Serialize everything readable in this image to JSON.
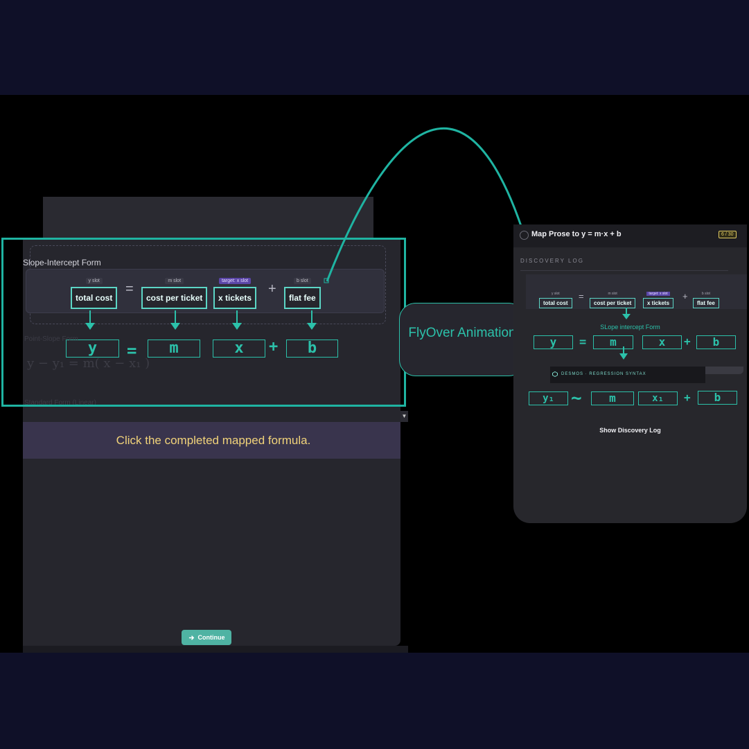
{
  "left_panel": {
    "section_title": "Slope-Intercept Form",
    "slots": [
      {
        "tag": "y slot",
        "label": "total cost",
        "target": false
      },
      {
        "tag": "m slot",
        "label": "cost per ticket",
        "target": false
      },
      {
        "tag": "target: x slot",
        "label": "x tickets",
        "target": true
      },
      {
        "tag": "b slot",
        "label": "flat fee",
        "target": false
      }
    ],
    "equals": "=",
    "plus": "+",
    "formula": {
      "y": "y",
      "m": "m",
      "x": "x",
      "b": "b",
      "equals": "=",
      "plus": "+"
    },
    "faint_heading_1": "Point-Slope Form",
    "faint_math": "y − y₁ = m( x − x₁ )",
    "faint_heading_2": "Standard Form (Linear)",
    "prompt": "Click the completed mapped formula.",
    "continue_label": "Continue",
    "continue_icon": "arrow-right-icon"
  },
  "flyover": {
    "label": "FlyOver Animation"
  },
  "right_panel": {
    "title": "Map Prose to y = m·x + b",
    "badge": "6 / 30",
    "log_heading": "DISCOVERY LOG",
    "slots": [
      {
        "tag": "y slot",
        "label": "total cost",
        "target": false
      },
      {
        "tag": "m slot",
        "label": "cost per ticket",
        "target": false
      },
      {
        "tag": "target: x slot",
        "label": "x tickets",
        "target": true
      },
      {
        "tag": "b slot",
        "label": "flat fee",
        "target": false
      }
    ],
    "equals": "=",
    "plus": "+",
    "form_label": "SLope intercept Form",
    "formula": {
      "y": "y",
      "m": "m",
      "x": "x",
      "b": "b",
      "equals": "=",
      "plus": "+"
    },
    "desmos_label": "DESMOS · REGRESSION SYNTAX",
    "regression": {
      "y": "y₁",
      "tilde": "~",
      "m": "m",
      "x": "x₁",
      "plus": "+",
      "b": "b"
    },
    "show_log": "Show Discovery Log"
  },
  "colors": {
    "accent": "#2cc1aa",
    "prompt_text": "#f1d37a",
    "background": "#0f1028",
    "badge": "#e2cc62"
  }
}
